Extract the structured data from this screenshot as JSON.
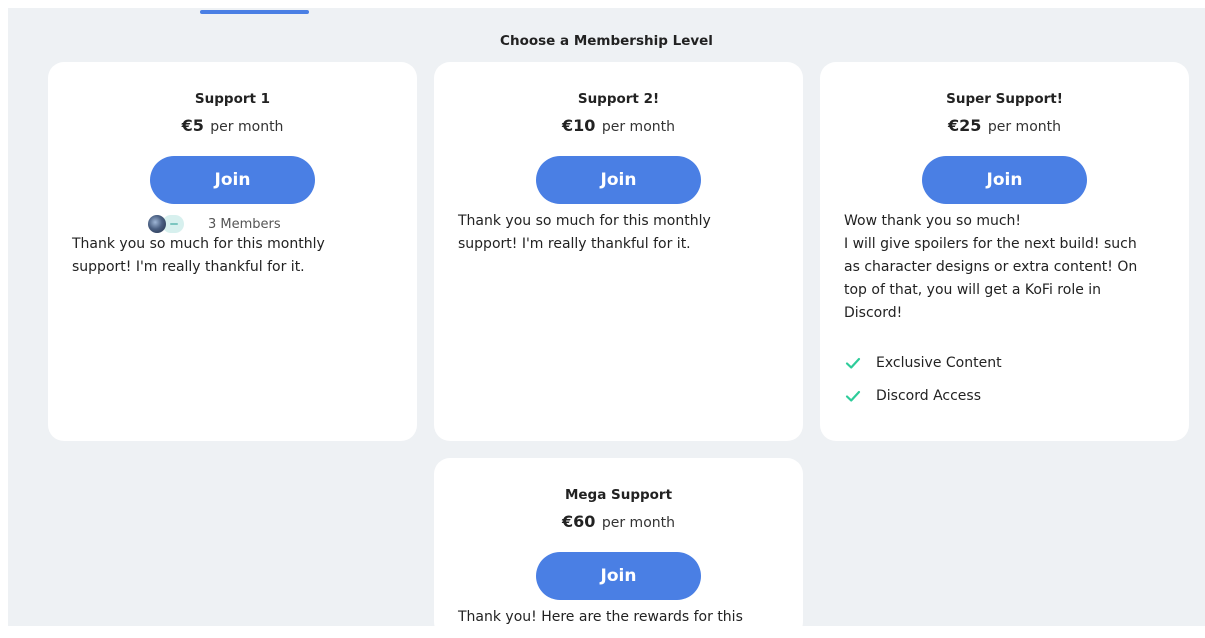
{
  "section_title": "Choose a Membership Level",
  "colors": {
    "accent": "#4a7fe4",
    "check": "#2ecc9a",
    "background": "#eef1f4",
    "card": "#ffffff"
  },
  "tiers": [
    {
      "name": "Support 1",
      "price": "€5",
      "period": "per month",
      "button": "Join",
      "members": "3 Members",
      "description": [
        "Thank you so much for this monthly",
        "support! I'm really thankful for it."
      ]
    },
    {
      "name": "Support 2!",
      "price": "€10",
      "period": "per month",
      "button": "Join",
      "description": [
        "Thank you so much for this monthly",
        "support! I'm really thankful for it."
      ]
    },
    {
      "name": "Super Support!",
      "price": "€25",
      "period": "per month",
      "button": "Join",
      "description": [
        "Wow thank you so much!",
        "I will give spoilers for the next build! such",
        "as character designs or extra content! On",
        "top of that, you will get a KoFi role in",
        "Discord!"
      ],
      "perks": [
        "Exclusive Content",
        "Discord Access"
      ]
    },
    {
      "name": "Mega Support",
      "price": "€60",
      "period": "per month",
      "button": "Join",
      "description": [
        "Thank you! Here are the rewards for this"
      ]
    }
  ]
}
